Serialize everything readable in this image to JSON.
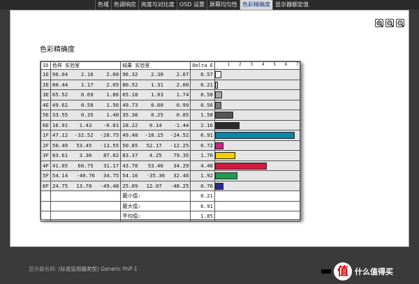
{
  "tabs": [
    {
      "label": "色域",
      "active": false
    },
    {
      "label": "色调响应",
      "active": false
    },
    {
      "label": "亮度与对比度",
      "active": false
    },
    {
      "label": "OSD 设置",
      "active": false
    },
    {
      "label": "屏幕均匀性",
      "active": false
    },
    {
      "label": "色彩精确度",
      "active": true
    },
    {
      "label": "显示器额定值",
      "active": false
    }
  ],
  "section_title": "色彩精确度",
  "table": {
    "headers": {
      "id": "ID",
      "target": "色样 实验室",
      "result": "结果 实验室",
      "delta": "Delta E"
    },
    "axis_ticks": [
      "1",
      "2",
      "3",
      "4",
      "5",
      "6",
      "7"
    ],
    "axis_max": 7,
    "rows": [
      {
        "id": "1E",
        "t": [
          "96.04",
          "2.16",
          "2.60"
        ],
        "r": [
          "96.32",
          "2.30",
          "2.07"
        ],
        "de": "0.57",
        "dev": 0.57,
        "color": "#f2f2f2"
      },
      {
        "id": "2E",
        "t": [
          "80.44",
          "1.17",
          "2.05"
        ],
        "r": [
          "80.52",
          "1.31",
          "2.00"
        ],
        "de": "0.21",
        "dev": 0.21,
        "color": "#c8c8c8"
      },
      {
        "id": "3E",
        "t": [
          "65.52",
          "0.69",
          "1.86"
        ],
        "r": [
          "65.18",
          "1.03",
          "1.74"
        ],
        "de": "0.58",
        "dev": 0.58,
        "color": "#a6a6a6"
      },
      {
        "id": "4E",
        "t": [
          "49.62",
          "0.58",
          "1.56"
        ],
        "r": [
          "49.73",
          "0.60",
          "0.99"
        ],
        "de": "0.56",
        "dev": 0.56,
        "color": "#7a7a7a"
      },
      {
        "id": "5E",
        "t": [
          "33.55",
          "0.35",
          "1.40"
        ],
        "r": [
          "35.36",
          "0.25",
          "0.85"
        ],
        "de": "1.58",
        "dev": 1.58,
        "color": "#555555"
      },
      {
        "id": "6E",
        "t": [
          "16.91",
          "1.43",
          "-0.81"
        ],
        "r": [
          "18.22",
          "0.14",
          "-1.44"
        ],
        "de": "2.16",
        "dev": 2.16,
        "color": "#2b2b2b"
      },
      {
        "id": "1F",
        "t": [
          "47.12",
          "-32.52",
          "-28.75"
        ],
        "r": [
          "49.48",
          "-18.15",
          "-24.52"
        ],
        "de": "6.91",
        "dev": 6.91,
        "color": "#0a86a8"
      },
      {
        "id": "2F",
        "t": [
          "50.49",
          "53.45",
          "-13.55"
        ],
        "r": [
          "50.85",
          "52.17",
          "-12.25"
        ],
        "de": "0.72",
        "dev": 0.72,
        "color": "#c8268a"
      },
      {
        "id": "3F",
        "t": [
          "83.61",
          "3.36",
          "87.02"
        ],
        "r": [
          "83.37",
          "4.25",
          "79.35"
        ],
        "de": "1.76",
        "dev": 1.76,
        "color": "#f0d000"
      },
      {
        "id": "4F",
        "t": [
          "41.05",
          "60.75",
          "31.17"
        ],
        "r": [
          "43.78",
          "53.46",
          "34.29"
        ],
        "de": "4.48",
        "dev": 4.48,
        "color": "#d21a3e"
      },
      {
        "id": "5F",
        "t": [
          "54.14",
          "-40.76",
          "34.75"
        ],
        "r": [
          "54.16",
          "-35.36",
          "32.46"
        ],
        "de": "1.92",
        "dev": 1.92,
        "color": "#1e9b50"
      },
      {
        "id": "6F",
        "t": [
          "24.75",
          "13.78",
          "-49.48"
        ],
        "r": [
          "25.09",
          "12.07",
          "-48.25"
        ],
        "de": "0.76",
        "dev": 0.76,
        "color": "#2d2a8a"
      }
    ],
    "summary": [
      {
        "label": "最小值:",
        "value": "0.21"
      },
      {
        "label": "最大值:",
        "value": "6.91"
      },
      {
        "label": "平均值:",
        "value": "1.85"
      }
    ]
  },
  "footer": {
    "label": "显示器名称:",
    "value": "(标准监视器类型) Generic PnP-1"
  },
  "watermark": {
    "glyph": "值",
    "text": "什么值得买"
  }
}
